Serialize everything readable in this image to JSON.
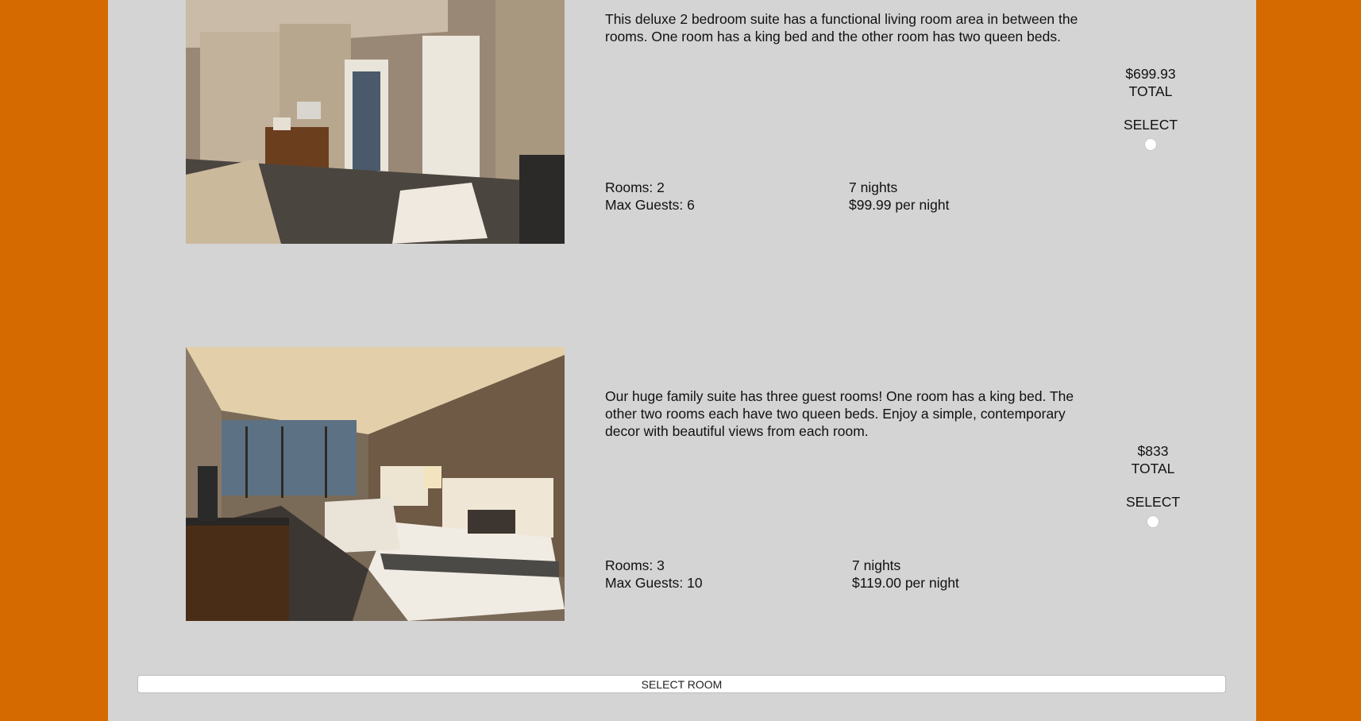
{
  "rooms": [
    {
      "description": "This deluxe 2 bedroom suite has a functional living room area in between the rooms. One room has a king bed and the other room has two queen beds.",
      "rooms_label": "Rooms: 2",
      "guests_label": "Max Guests: 6",
      "nights_label": "7 nights",
      "rate_label": "$99.99 per night",
      "total_price": "$699.93",
      "total_label": "TOTAL",
      "select_label": "SELECT",
      "photo_icon": "hotel-suite-living-room-photo"
    },
    {
      "description": "Our huge family suite has three guest rooms! One room has a king bed. The other two rooms each have two queen beds. Enjoy a simple, contemporary decor with beautiful views from each room.",
      "rooms_label": "Rooms: 3",
      "guests_label": "Max Guests: 10",
      "nights_label": "7 nights",
      "rate_label": "$119.00 per night",
      "total_price": "$833",
      "total_label": "TOTAL",
      "select_label": "SELECT",
      "photo_icon": "hotel-bedroom-photo"
    }
  ],
  "footer": {
    "select_room_label": "SELECT ROOM"
  },
  "colors": {
    "page_background": "#d46a00",
    "panel_background": "#d4d4d4"
  }
}
